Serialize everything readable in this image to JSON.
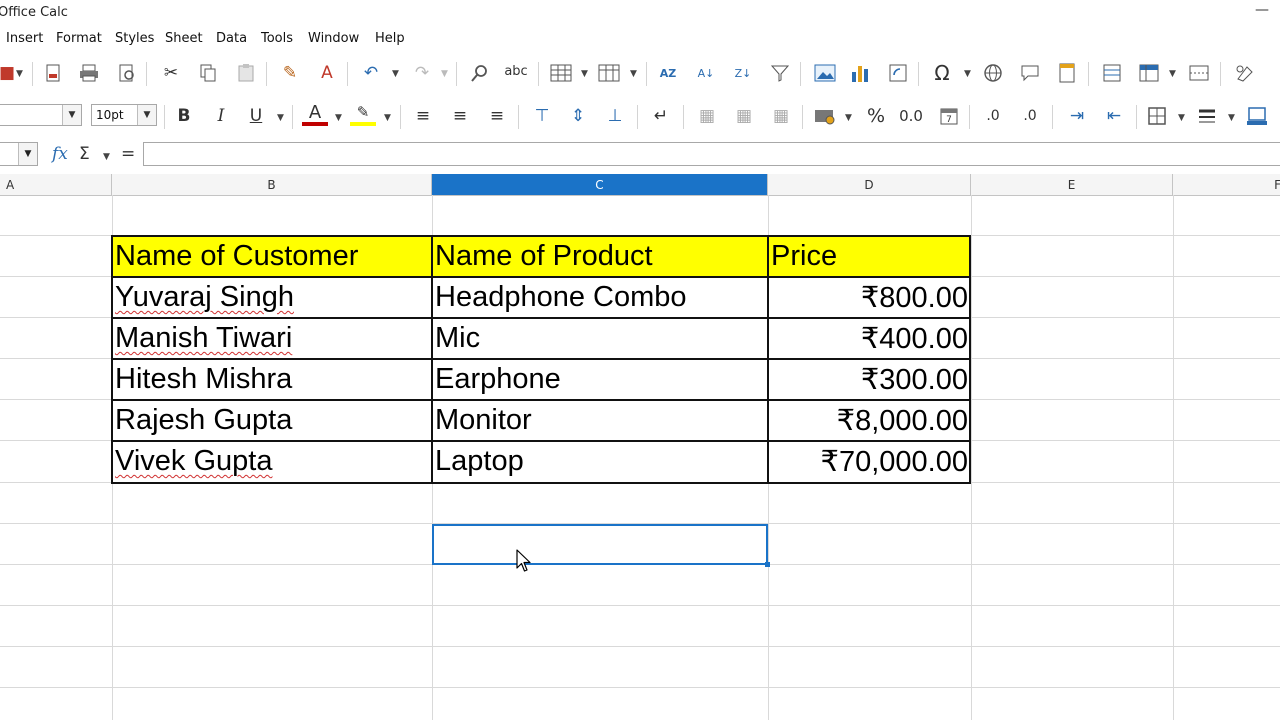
{
  "window": {
    "title": "Office Calc"
  },
  "menu": [
    "Insert",
    "Format",
    "Styles",
    "Sheet",
    "Data",
    "Tools",
    "Window",
    "Help"
  ],
  "toolbar2": {
    "font_size": "10pt"
  },
  "columns": [
    "A",
    "B",
    "C",
    "D",
    "E",
    "F"
  ],
  "selected_column": "C",
  "table": {
    "headers": [
      "Name of Customer",
      "Name of Product",
      "Price"
    ],
    "rows": [
      [
        "Yuvaraj Singh",
        "Headphone Combo",
        "₹800.00"
      ],
      [
        "Manish Tiwari",
        "Mic",
        "₹400.00"
      ],
      [
        "Hitesh Mishra",
        "Earphone",
        "₹300.00"
      ],
      [
        "Rajesh Gupta",
        "Monitor",
        "₹8,000.00"
      ],
      [
        "Vivek Gupta",
        "Laptop",
        "₹70,000.00"
      ]
    ]
  },
  "colors": {
    "accent": "#1a73c8",
    "header_fill": "#ffff00"
  }
}
